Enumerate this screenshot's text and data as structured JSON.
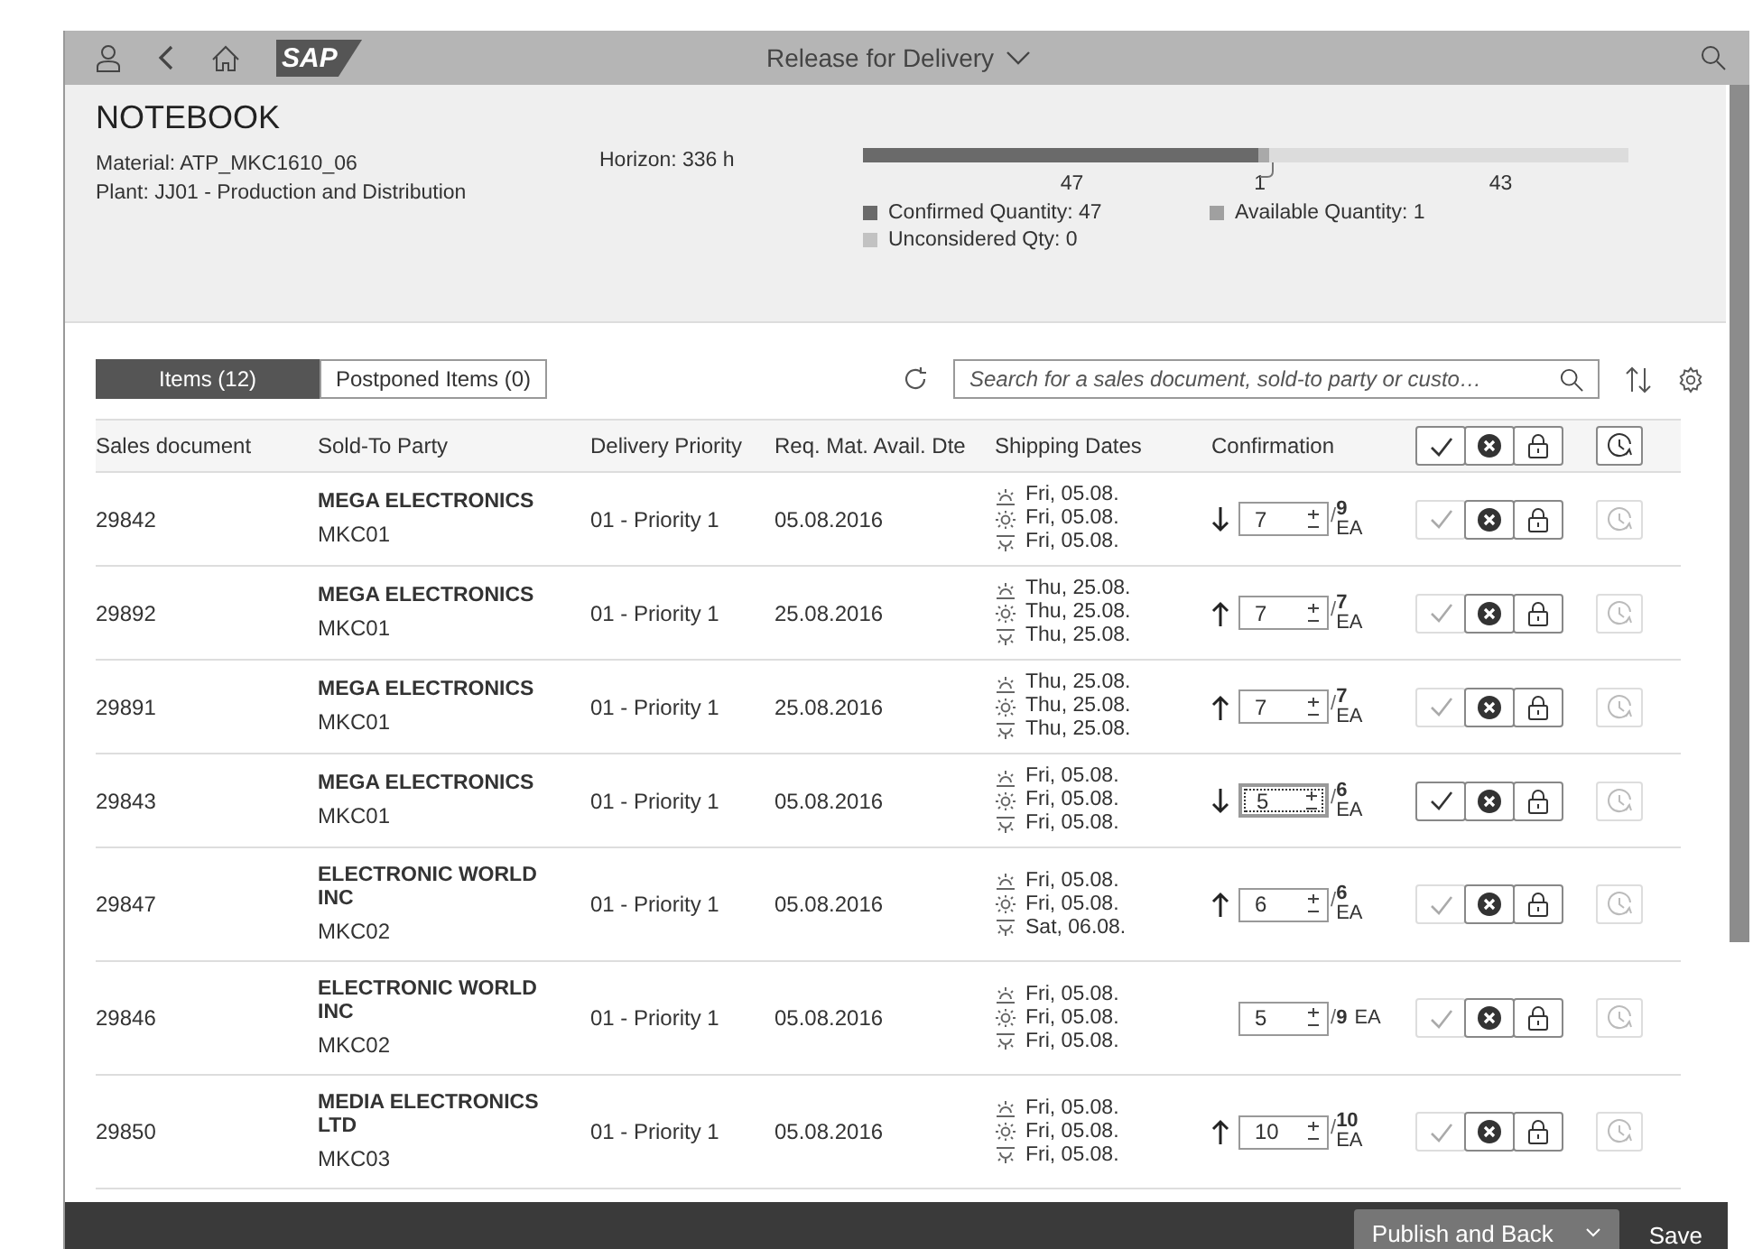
{
  "shell": {
    "logo": "SAP",
    "title": "Release for Delivery"
  },
  "header": {
    "title": "NOTEBOOK",
    "material": "Material: ATP_MKC1610_06",
    "plant": "Plant: JJ01 - Production and Distribution",
    "horizon": "Horizon: 336 h",
    "bar": {
      "confirmed": {
        "level": 0.516,
        "label": "47"
      },
      "available": {
        "label": "1"
      },
      "rest": {
        "label": "43"
      }
    },
    "legend": [
      {
        "label": "Confirmed Quantity: 47",
        "color": "#6a6a6a"
      },
      {
        "label": "Available Quantity: 1",
        "color": "#a0a0a0"
      },
      {
        "label": "Unconsidered Qty: 0",
        "color": "#c2c2c2"
      }
    ]
  },
  "tabs": [
    {
      "label": "Items (12)",
      "selected": true
    },
    {
      "label": "Postponed Items (0)",
      "selected": false
    }
  ],
  "search": {
    "placeholder": "Search for a sales document, sold-to party or custo…"
  },
  "columns": [
    "Sales document",
    "Sold-To Party",
    "Delivery Priority",
    "Req. Mat. Avail. Dte",
    "Shipping Dates",
    "Confirmation"
  ],
  "rows": [
    {
      "doc": "29842",
      "party": [
        "MEGA ELECTRONICS"
      ],
      "code": "MKC01",
      "priority": "01 - Priority 1",
      "date": "05.08.2016",
      "ship": [
        "Fri, 05.08.",
        "Fri, 05.08.",
        "Fri, 05.08."
      ],
      "kind": "trend_down",
      "qty": "7",
      "separator": "/",
      "total": "9",
      "unit": "EA",
      "unit_inline": false,
      "focused": false,
      "accept_enabled": false
    },
    {
      "doc": "29892",
      "party": [
        "MEGA ELECTRONICS"
      ],
      "code": "MKC01",
      "priority": "01 - Priority 1",
      "date": "25.08.2016",
      "ship": [
        "Thu, 25.08.",
        "Thu, 25.08.",
        "Thu, 25.08."
      ],
      "kind": "trend_up",
      "qty": "7",
      "separator": "/",
      "total": "7",
      "unit": "EA",
      "unit_inline": false,
      "focused": false,
      "accept_enabled": false
    },
    {
      "doc": "29891",
      "party": [
        "MEGA ELECTRONICS"
      ],
      "code": "MKC01",
      "priority": "01 - Priority 1",
      "date": "25.08.2016",
      "ship": [
        "Thu, 25.08.",
        "Thu, 25.08.",
        "Thu, 25.08."
      ],
      "kind": "trend_up",
      "qty": "7",
      "separator": "/",
      "total": "7",
      "unit": "EA",
      "unit_inline": false,
      "focused": false,
      "accept_enabled": false
    },
    {
      "doc": "29843",
      "party": [
        "MEGA ELECTRONICS"
      ],
      "code": "MKC01",
      "priority": "01 - Priority 1",
      "date": "05.08.2016",
      "ship": [
        "Fri, 05.08.",
        "Fri, 05.08.",
        "Fri, 05.08."
      ],
      "kind": "trend_down",
      "qty": "5",
      "separator": "/",
      "total": "6",
      "unit": "EA",
      "unit_inline": false,
      "focused": true,
      "accept_enabled": true
    },
    {
      "doc": "29847",
      "party": [
        "ELECTRONIC WORLD",
        "INC"
      ],
      "code": "MKC02",
      "priority": "01 - Priority 1",
      "date": "05.08.2016",
      "ship": [
        "Fri, 05.08.",
        "Fri, 05.08.",
        "Sat, 06.08."
      ],
      "kind": "trend_up",
      "qty": "6",
      "separator": "/",
      "total": "6",
      "unit": "EA",
      "unit_inline": false,
      "focused": false,
      "accept_enabled": false
    },
    {
      "doc": "29846",
      "party": [
        "ELECTRONIC WORLD",
        "INC"
      ],
      "code": "MKC02",
      "priority": "01 - Priority 1",
      "date": "05.08.2016",
      "ship": [
        "Fri, 05.08.",
        "Fri, 05.08.",
        "Fri, 05.08."
      ],
      "kind": "no_trend",
      "qty": "5",
      "separator": "/",
      "total": "9",
      "unit": "EA",
      "unit_inline": true,
      "focused": false,
      "accept_enabled": false
    },
    {
      "doc": "29850",
      "party": [
        "MEDIA ELECTRONICS",
        "LTD"
      ],
      "code": "MKC03",
      "priority": "01 - Priority 1",
      "date": "05.08.2016",
      "ship": [
        "Fri, 05.08.",
        "Fri, 05.08.",
        "Fri, 05.08."
      ],
      "kind": "trend_up",
      "qty": "10",
      "separator": "/",
      "total": "10",
      "unit": "EA",
      "unit_inline": false,
      "focused": false,
      "accept_enabled": false
    }
  ],
  "footer": {
    "buttons": [
      "Publish and Back",
      "Save"
    ]
  }
}
